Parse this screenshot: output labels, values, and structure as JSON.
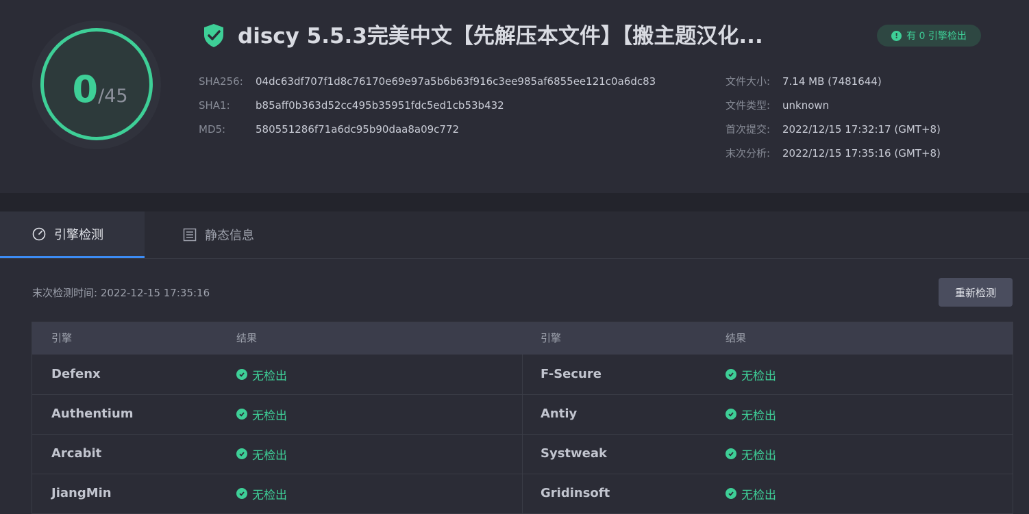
{
  "score": {
    "detected": "0",
    "total": "/45"
  },
  "file": {
    "title": "discy 5.5.3完美中文【先解压本文件】【搬主题汉化..."
  },
  "badge": {
    "text": "有 0 引擎检出"
  },
  "hashes": [
    {
      "label": "SHA256:",
      "value": "04dc63df707f1d8c76170e69e97a5b6b63f916c3ee985af6855ee121c0a6dc83"
    },
    {
      "label": "SHA1:",
      "value": "b85aff0b363d52cc495b35951fdc5ed1cb53b432"
    },
    {
      "label": "MD5:",
      "value": "580551286f71a6dc95b90daa8a09c772"
    }
  ],
  "meta": [
    {
      "label": "文件大小:",
      "value": "7.14 MB (7481644)"
    },
    {
      "label": "文件类型:",
      "value": "unknown"
    },
    {
      "label": "首次提交:",
      "value": "2022/12/15 17:32:17 (GMT+8)"
    },
    {
      "label": "末次分析:",
      "value": "2022/12/15 17:35:16 (GMT+8)"
    }
  ],
  "tabs": [
    {
      "label": "引擎检测",
      "icon": "gauge-icon",
      "active": true
    },
    {
      "label": "静态信息",
      "icon": "document-list-icon",
      "active": false
    }
  ],
  "scan": {
    "last_scan": "末次检测时间: 2022-12-15 17:35:16",
    "rescan_label": "重新检测"
  },
  "table": {
    "headers": [
      "引擎",
      "结果",
      "引擎",
      "结果"
    ],
    "rows": [
      {
        "left_engine": "Defenx",
        "left_result": "无检出",
        "right_engine": "F-Secure",
        "right_result": "无检出"
      },
      {
        "left_engine": "Authentium",
        "left_result": "无检出",
        "right_engine": "Antiy",
        "right_result": "无检出"
      },
      {
        "left_engine": "Arcabit",
        "left_result": "无检出",
        "right_engine": "Systweak",
        "right_result": "无检出"
      },
      {
        "left_engine": "JiangMin",
        "left_result": "无检出",
        "right_engine": "Gridinsoft",
        "right_result": "无检出"
      }
    ]
  },
  "colors": {
    "accent": "#3ecf97",
    "tab_active": "#3c8cf5",
    "background": "#2b2c36"
  }
}
